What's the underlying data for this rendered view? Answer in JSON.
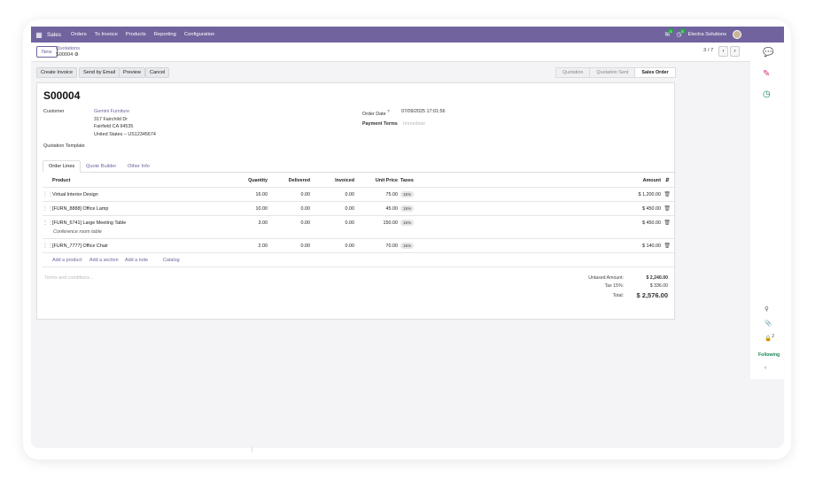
{
  "topbar": {
    "app": "Sales",
    "menus": [
      "Orders",
      "To Invoice",
      "Products",
      "Reporting",
      "Configuration"
    ],
    "chat_badge": "5",
    "activity_badge": "5",
    "company": "Electra Solutions"
  },
  "control": {
    "new_label": "New",
    "breadcrumb_parent": "Quotations",
    "breadcrumb_current": "S00004",
    "pager": "3 / 7"
  },
  "actions": {
    "create_invoice": "Create Invoice",
    "send_email": "Send by Email",
    "preview": "Preview",
    "cancel": "Cancel",
    "statuses": [
      "Quotation",
      "Quotation Sent",
      "Sales Order"
    ]
  },
  "form": {
    "title": "S00004",
    "customer_label": "Customer",
    "customer_name": "Gemini Furniture",
    "address1": "317 Fairchild Dr",
    "address2": "Fairfield CA 94535",
    "address3": "United States – US12345674",
    "order_date_label": "Order Date",
    "order_date": "07/09/2025 17:01:56",
    "payment_terms_label": "Payment Terms",
    "payment_terms_placeholder": "Immediate",
    "quotation_template_label": "Quotation Template"
  },
  "tabs": [
    "Order Lines",
    "Quote Builder",
    "Other Info"
  ],
  "lines": {
    "headers": {
      "product": "Product",
      "quantity": "Quantity",
      "delivered": "Delivered",
      "invoiced": "Invoiced",
      "unit_price": "Unit Price",
      "taxes": "Taxes",
      "amount": "Amount"
    },
    "rows": [
      {
        "product": "Virtual Interior Design",
        "note": "",
        "quantity": "16.00",
        "delivered": "0.00",
        "invoiced": "0.00",
        "unit_price": "75.00",
        "tax": "15%",
        "amount": "$ 1,200.00"
      },
      {
        "product": "[FURN_8888] Office Lamp",
        "note": "",
        "quantity": "10.00",
        "delivered": "0.00",
        "invoiced": "0.00",
        "unit_price": "45.00",
        "tax": "15%",
        "amount": "$ 450.00"
      },
      {
        "product": "[FURN_6741] Large Meeting Table",
        "note": "Conference room table",
        "quantity": "3.00",
        "delivered": "0.00",
        "invoiced": "0.00",
        "unit_price": "150.00",
        "tax": "15%",
        "amount": "$ 450.00"
      },
      {
        "product": "[FURN_7777] Office Chair",
        "note": "",
        "quantity": "2.00",
        "delivered": "0.00",
        "invoiced": "0.00",
        "unit_price": "70.00",
        "tax": "15%",
        "amount": "$ 140.00"
      }
    ],
    "add_product": "Add a product",
    "add_section": "Add a section",
    "add_note": "Add a note",
    "catalog": "Catalog"
  },
  "terms_placeholder": "Terms and conditions...",
  "totals": {
    "untaxed_label": "Untaxed Amount:",
    "untaxed": "$ 2,240.00",
    "tax_label": "Tax 15%:",
    "tax": "$ 336.00",
    "total_label": "Total:",
    "total": "$ 2,576.00"
  },
  "chatter": {
    "attachments_count": "2",
    "following": "Following"
  }
}
